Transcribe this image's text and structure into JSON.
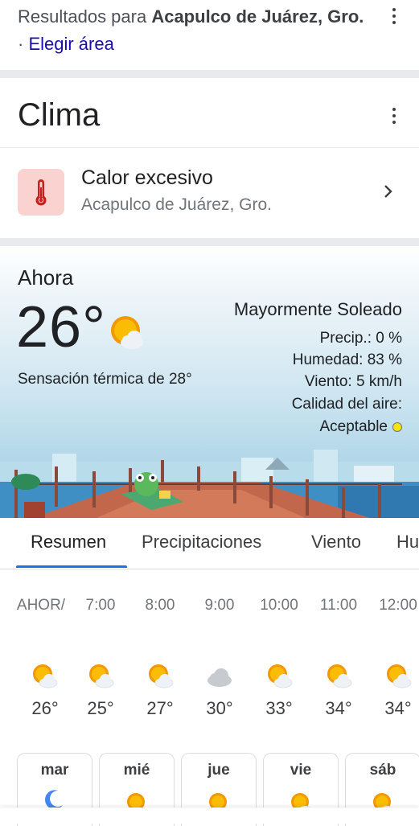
{
  "results": {
    "prefix": "Resultados para ",
    "location": "Acapulco de Juárez, Gro.",
    "separator": " · ",
    "link": "Elegir área"
  },
  "card": {
    "title": "Clima"
  },
  "alert": {
    "title": "Calor excesivo",
    "subtitle": "Acapulco de Juárez, Gro.",
    "icon": "thermometer-icon"
  },
  "current": {
    "now_label": "Ahora",
    "temperature": "26°",
    "feels_like": "Sensación térmica de 28°",
    "condition": "Mayormente Soleado",
    "precip": "Precip.: 0 %",
    "humidity": "Humedad: 83 %",
    "wind": "Viento: 5 km/h",
    "air_quality_label": "Calidad del aire:",
    "air_quality_value": "Aceptable",
    "air_quality_color": "#f5e50a"
  },
  "tabs": [
    "Resumen",
    "Precipitaciones",
    "Viento",
    "Hu"
  ],
  "hourly": [
    {
      "time": "AHOR/",
      "icon": "partly-sunny-icon",
      "temp": "26°"
    },
    {
      "time": "7:00",
      "icon": "partly-sunny-icon",
      "temp": "25°"
    },
    {
      "time": "8:00",
      "icon": "partly-sunny-icon",
      "temp": "27°"
    },
    {
      "time": "9:00",
      "icon": "cloud-icon",
      "temp": "30°"
    },
    {
      "time": "10:00",
      "icon": "partly-sunny-icon",
      "temp": "33°"
    },
    {
      "time": "11:00",
      "icon": "partly-sunny-icon",
      "temp": "34°"
    },
    {
      "time": "12:00",
      "icon": "partly-sunny-icon",
      "temp": "34°"
    }
  ],
  "daily": [
    {
      "day": "mar",
      "icon": "moon-icon"
    },
    {
      "day": "mié",
      "icon": "sun-icon"
    },
    {
      "day": "jue",
      "icon": "sun-icon"
    },
    {
      "day": "vie",
      "icon": "partly-sunny-icon"
    },
    {
      "day": "sáb",
      "icon": "partly-sunny-icon"
    }
  ],
  "colors": {
    "link": "#1a0dab",
    "tab_underline": "#1a73e8",
    "alert_bg": "#fad2cf",
    "alert_icon": "#c5221f",
    "sun": "#f29900"
  }
}
